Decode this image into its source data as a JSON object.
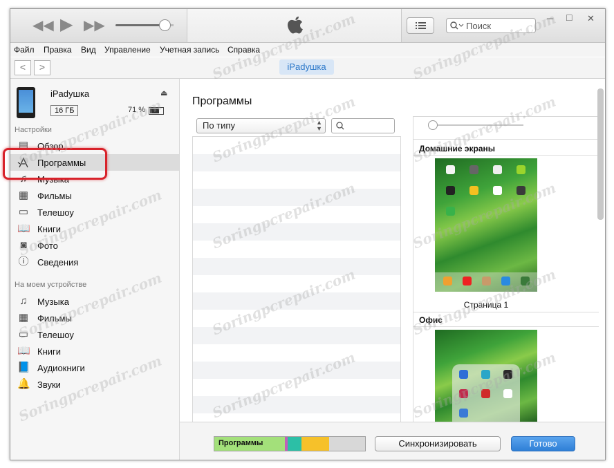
{
  "menu": [
    "Файл",
    "Правка",
    "Вид",
    "Управление",
    "Учетная запись",
    "Справка"
  ],
  "toolbar": {
    "search_placeholder": "Поиск",
    "minimize": "─",
    "maximize": "□",
    "close": "✕"
  },
  "nav": {
    "back": "<",
    "forward": ">",
    "device_pill": "iPadушка"
  },
  "device": {
    "name": "iPadушка",
    "capacity": "16 ГБ",
    "battery": "71 %",
    "battery_level": 0.71
  },
  "sidebar": {
    "settings_header": "Настройки",
    "settings_items": [
      {
        "label": "Обзор",
        "icon": "overview-icon"
      },
      {
        "label": "Программы",
        "icon": "apps-icon"
      },
      {
        "label": "Музыка",
        "icon": "music-icon"
      },
      {
        "label": "Фильмы",
        "icon": "film-icon"
      },
      {
        "label": "Телешоу",
        "icon": "tv-icon"
      },
      {
        "label": "Книги",
        "icon": "book-icon"
      },
      {
        "label": "Фото",
        "icon": "camera-icon"
      },
      {
        "label": "Сведения",
        "icon": "info-icon"
      }
    ],
    "device_header": "На моем устройстве",
    "device_items": [
      {
        "label": "Музыка",
        "icon": "music-icon"
      },
      {
        "label": "Фильмы",
        "icon": "film-icon"
      },
      {
        "label": "Телешоу",
        "icon": "tv-icon"
      },
      {
        "label": "Книги",
        "icon": "book-icon"
      },
      {
        "label": "Аудиокниги",
        "icon": "audiobook-icon"
      },
      {
        "label": "Звуки",
        "icon": "bell-icon"
      }
    ]
  },
  "main": {
    "title": "Программы",
    "sort_value": "По типу",
    "home_screens_header": "Домашние экраны",
    "page_label": "Страница 1",
    "office_header": "Офис"
  },
  "bottom": {
    "capacity_label": "Программы",
    "sync_button": "Синхронизировать",
    "done_button": "Готово"
  },
  "colors": {
    "accent": "#2f7fd6",
    "highlight": "#d8222a",
    "apps_segment": "#a3e07a"
  },
  "watermark": "Soringpcrepair.com"
}
